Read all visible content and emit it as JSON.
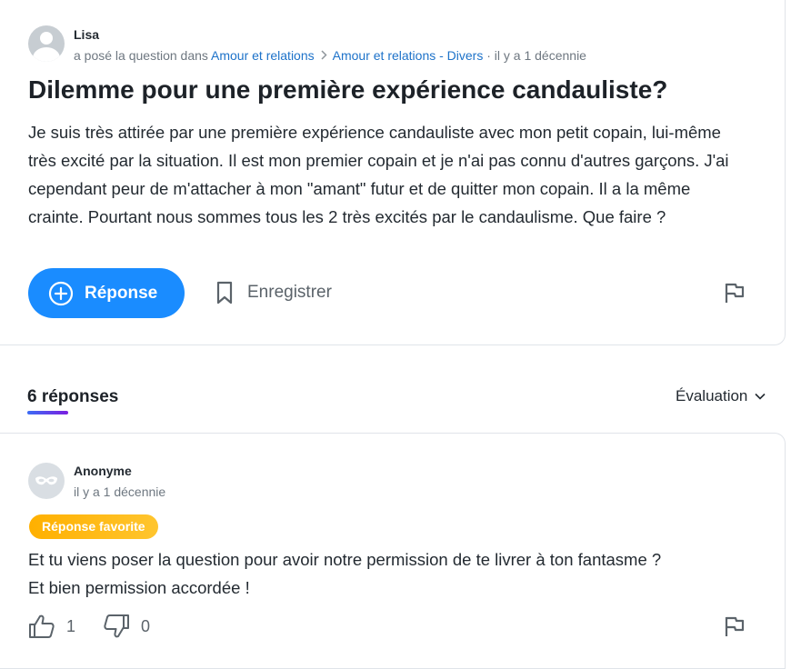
{
  "question": {
    "author": "Lisa",
    "meta_prefix": "a posé la question dans",
    "category": "Amour et relations",
    "subcategory": "Amour et relations - Divers",
    "time": "· il y a 1 décennie",
    "title": "Dilemme pour une première expérience candauliste?",
    "body": "Je suis très attirée par une première expérience candauliste avec mon petit copain, lui-même très excité par la situation. Il est mon premier copain et je n'ai pas connu d'autres garçons. J'ai cependant peur de m'attacher à mon \"amant\" futur et de quitter mon copain. Il a la même crainte. Pourtant nous sommes tous les 2 très excités par le candaulisme. Que faire ?",
    "answer_button": "Réponse",
    "save_button": "Enregistrer",
    "icons": [
      "plus-circle-icon",
      "bookmark-icon",
      "flag-icon"
    ]
  },
  "answers_header": {
    "count_label": "6 réponses",
    "sort_label": "Évaluation",
    "underline_colors": [
      "#3c6cf5",
      "#7b1ee0"
    ]
  },
  "answer": {
    "author": "Anonyme",
    "time": "il y a 1 décennie",
    "badge": "Réponse favorite",
    "line1": "Et tu viens poser la question pour avoir notre permission de te livrer à ton fantasme ?",
    "line2": "Et bien permission accordée !",
    "upvotes": "1",
    "downvotes": "0",
    "icons": [
      "mask-icon",
      "thumbs-up-icon",
      "thumbs-down-icon",
      "flag-icon"
    ]
  },
  "colors": {
    "accent": "#1a8cff",
    "link": "#1d72c9",
    "badge": "#ffb000"
  }
}
